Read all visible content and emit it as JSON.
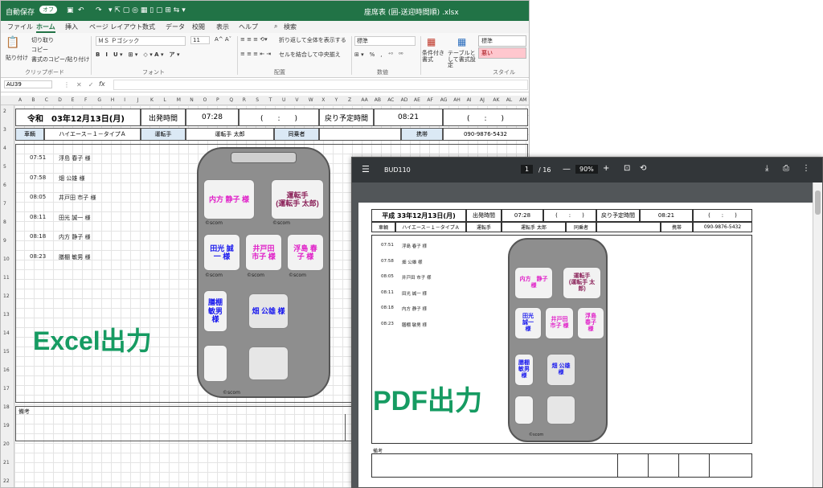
{
  "excel": {
    "autosave": "自動保存",
    "autosave_state": "オフ",
    "filename": "座席表 (囲-送迎時間順) .xlsx",
    "tabs": [
      "ファイル",
      "ホーム",
      "挿入",
      "ページ レイアウト",
      "数式",
      "データ",
      "校閲",
      "表示",
      "ヘルプ"
    ],
    "search": "検索",
    "ribbon": {
      "paste": "貼り付け",
      "cut": "切り取り",
      "copy": "コピー",
      "format_painter": "書式のコピー/貼り付け",
      "clipboard": "クリップボード",
      "font_name": "ＭＳ Ｐゴシック",
      "font_size": "11",
      "font_group": "フォント",
      "wrap": "折り返して全体を表示する",
      "merge": "セルを結合して中央揃え",
      "align_group": "配置",
      "number_format": "標準",
      "number_group": "数値",
      "cond_format": "条件付き書式",
      "table_format": "テーブルとして書式設定",
      "style_normal": "標準",
      "style_bad": "悪い",
      "style_group": "スタイル"
    },
    "namebox": "AU39",
    "fx": "fx",
    "columns": [
      "A",
      "B",
      "C",
      "D",
      "E",
      "F",
      "G",
      "H",
      "I",
      "J",
      "K",
      "L",
      "M",
      "N",
      "O",
      "P",
      "Q",
      "R",
      "S",
      "T",
      "U",
      "V",
      "W",
      "X",
      "Y",
      "Z",
      "AA",
      "AB",
      "AC",
      "AD",
      "AE",
      "AF",
      "AG",
      "AH",
      "AI",
      "AJ",
      "AK",
      "AL",
      "AM"
    ],
    "rows": [
      "2",
      "3",
      "4",
      "5",
      "6",
      "7",
      "8",
      "9",
      "10",
      "11",
      "12",
      "13",
      "14",
      "15",
      "16",
      "17",
      "18",
      "19",
      "20",
      "21",
      "22"
    ],
    "header": {
      "date": "令和　03年12月13日(月)",
      "depart_label": "出発時間",
      "depart": "07:28",
      "blank_time": "(　　:　　)",
      "return_label": "戻り予定時間",
      "return": "08:21",
      "vehicle_label": "車輌",
      "vehicle": "ハイエース－１－タイプＡ",
      "driver_label": "運転手",
      "driver": "運転手 太郎",
      "companion_label": "同乗者",
      "phone_label": "携帯",
      "phone": "090-9876-5432"
    },
    "schedule": [
      {
        "time": "07:51",
        "name": "浮島 春子 様"
      },
      {
        "time": "07:58",
        "name": "畑 公雄 様"
      },
      {
        "time": "08:05",
        "name": "井戸田 市子 様"
      },
      {
        "time": "08:11",
        "name": "田光 誠一 様"
      },
      {
        "time": "08:18",
        "name": "内方 静子 様"
      },
      {
        "time": "08:23",
        "name": "膳棚 敏男 様"
      }
    ],
    "seats": {
      "front_left": "内方 静子 様",
      "front_right": "運転手\n(運転手 太郎)",
      "mid_left": "田光 誠\n一 様",
      "mid_center": "井戸田\n市子 様",
      "mid_right": "浮島 春\n子 様",
      "rear_left": "膳棚\n敏男\n様",
      "rear_right": "畑 公雄 様"
    },
    "scom": "©scom",
    "remarks": "備考",
    "caption": "Excel出力"
  },
  "pdf": {
    "title": "BUD110",
    "page_current": "1",
    "page_total": "/ 16",
    "zoom": "90%",
    "header": {
      "date": "平成 33年12月13日(月)",
      "depart_label": "出発時間",
      "depart": "07:28",
      "blank_time": "(　　:　　)",
      "return_label": "戻り予定時間",
      "return": "08:21",
      "vehicle_label": "車輌",
      "vehicle": "ハイエース－１－タイプＡ",
      "driver_label": "運転手",
      "driver": "運転手 太郎",
      "companion_label": "同乗者",
      "phone_label": "携帯",
      "phone": "090-9876-5432"
    },
    "schedule": [
      {
        "time": "07:51",
        "name": "浮島 春子 様"
      },
      {
        "time": "07:58",
        "name": "畑 公雄 様"
      },
      {
        "time": "08:05",
        "name": "井戸田 市子 様"
      },
      {
        "time": "08:11",
        "name": "田光 誠一 様"
      },
      {
        "time": "08:18",
        "name": "内方 静子 様"
      },
      {
        "time": "08:23",
        "name": "膳棚 敏男 様"
      }
    ],
    "seats": {
      "front_left": "内方　静子\n様",
      "front_right": "運転手\n(運転手 太\n郎)",
      "mid_left": "田光\n誠一\n様",
      "mid_center": "井戸田\n市子 様",
      "mid_right": "浮島\n春子\n様",
      "rear_left": "膳棚\n敏男\n様",
      "rear_right": "畑 公雄\n様"
    },
    "scom": "©scom",
    "remarks": "備考",
    "caption": "PDF出力"
  },
  "colors": {
    "excel_green": "#217346",
    "caption_green": "#169b62",
    "magenta": "#e020c8",
    "blue": "#1a1aee",
    "driver_purple": "#8a2058"
  }
}
